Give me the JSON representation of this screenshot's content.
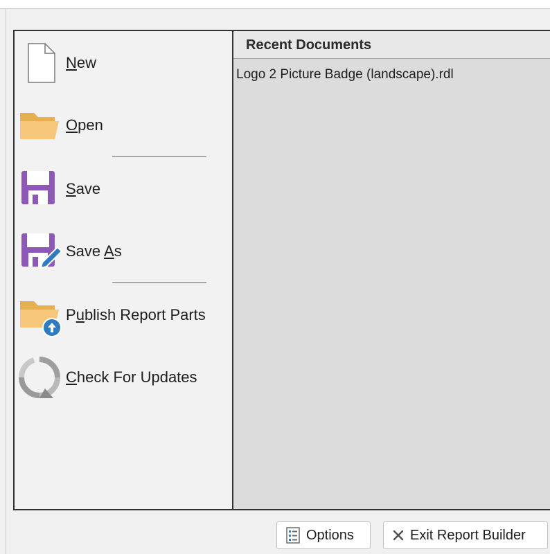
{
  "menu": {
    "items": [
      {
        "label": "New",
        "mnemonic": "N",
        "icon": "new-document-icon"
      },
      {
        "label": "Open",
        "mnemonic": "O",
        "icon": "folder-icon"
      },
      {
        "label": "Save",
        "mnemonic": "S",
        "icon": "floppy-disk-icon"
      },
      {
        "label": "Save As",
        "mnemonic": "A",
        "icon": "floppy-disk-pencil-icon"
      },
      {
        "label": "Publish Report Parts",
        "mnemonic": "u",
        "icon": "folder-upload-icon"
      },
      {
        "label": "Check For Updates",
        "mnemonic": "C",
        "icon": "refresh-arrows-icon"
      }
    ]
  },
  "recent": {
    "header": "Recent Documents",
    "documents": [
      "Logo 2 Picture Badge (landscape).rdl"
    ]
  },
  "footer": {
    "options_label": "Options",
    "exit_label": "Exit Report Builder"
  },
  "colors": {
    "accent_purple": "#8e58b8",
    "folder_orange": "#f6c77a",
    "badge_blue": "#2f7bbf",
    "recent_bg": "#dcdcdc"
  }
}
